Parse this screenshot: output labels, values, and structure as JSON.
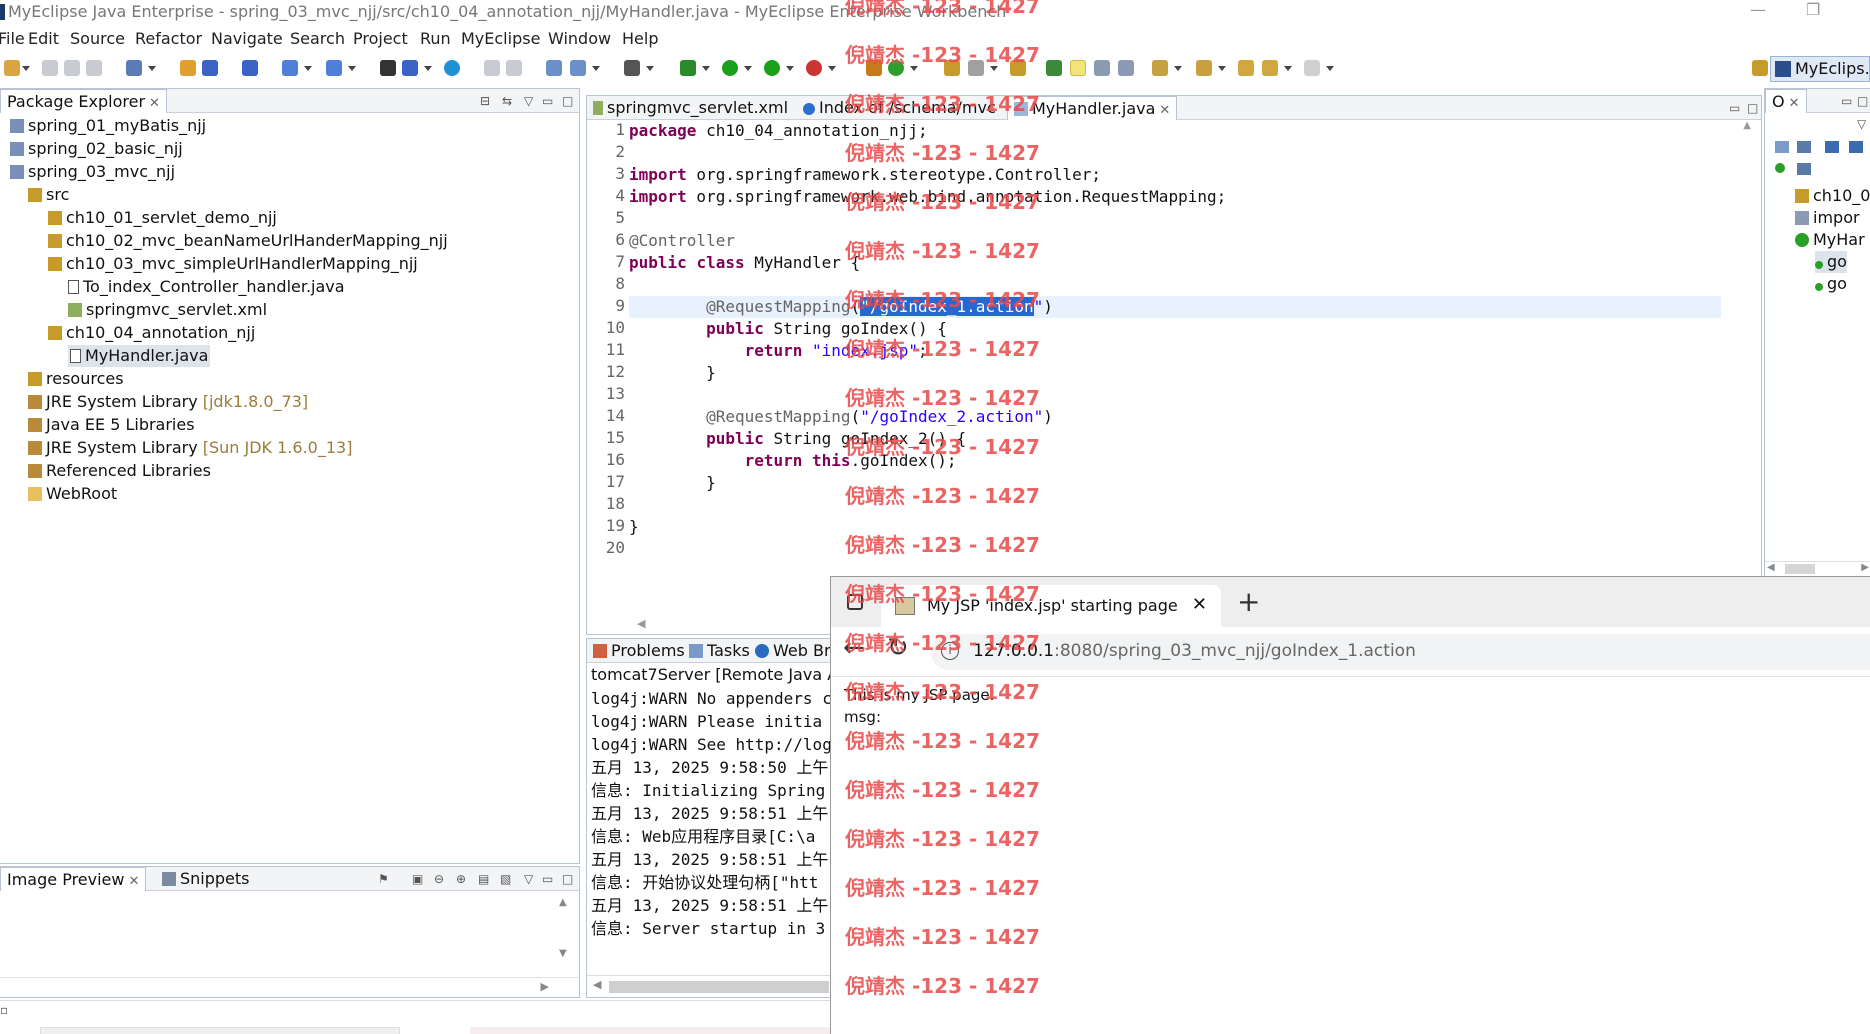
{
  "window": {
    "title": "MyEclipse Java Enterprise - spring_03_mvc_njj/src/ch10_04_annotation_njj/MyHandler.java - MyEclipse Enterprise Workbench"
  },
  "menu": [
    "File",
    "Edit",
    "Source",
    "Refactor",
    "Navigate",
    "Search",
    "Project",
    "Run",
    "MyEclipse",
    "Window",
    "Help"
  ],
  "perspective": {
    "label": "MyEclips..."
  },
  "package_explorer": {
    "title": "Package Explorer",
    "items": [
      {
        "label": "spring_01_myBatis_njj",
        "icon": "project-icon",
        "level": 0
      },
      {
        "label": "spring_02_basic_njj",
        "icon": "project-icon",
        "level": 0
      },
      {
        "label": "spring_03_mvc_njj",
        "icon": "project-icon",
        "level": 0
      },
      {
        "label": "src",
        "icon": "source-folder-icon",
        "level": 1
      },
      {
        "label": "ch10_01_servlet_demo_njj",
        "icon": "package-icon",
        "level": 2
      },
      {
        "label": "ch10_02_mvc_beanNameUrlHanderMapping_njj",
        "icon": "package-icon",
        "level": 2
      },
      {
        "label": "ch10_03_mvc_simpleUrlHandlerMapping_njj",
        "icon": "package-icon",
        "level": 2
      },
      {
        "label": "To_index_Controller_handler.java",
        "icon": "java-file-icon",
        "level": 3
      },
      {
        "label": "springmvc_servlet.xml",
        "icon": "xml-file-icon",
        "level": 3
      },
      {
        "label": "ch10_04_annotation_njj",
        "icon": "package-icon",
        "level": 2
      },
      {
        "label": "MyHandler.java",
        "icon": "java-file-icon",
        "level": 3,
        "selected": true
      },
      {
        "label": "resources",
        "icon": "source-folder-icon",
        "level": 1
      },
      {
        "label": "JRE System Library",
        "decoration": "[jdk1.8.0_73]",
        "icon": "library-icon",
        "level": 1
      },
      {
        "label": "Java EE 5 Libraries",
        "icon": "library-icon",
        "level": 1
      },
      {
        "label": "JRE System Library",
        "decoration": "[Sun JDK 1.6.0_13]",
        "icon": "library-icon",
        "level": 1
      },
      {
        "label": "Referenced Libraries",
        "icon": "library-icon",
        "level": 1
      },
      {
        "label": "WebRoot",
        "icon": "folder-icon",
        "level": 1
      }
    ]
  },
  "bottom_left": {
    "tabs": [
      "Image Preview",
      "Snippets"
    ]
  },
  "editor": {
    "tabs": [
      "springmvc_servlet.xml",
      "Index of /schema/mvc",
      "MyHandler.java"
    ],
    "active_tab": 2,
    "line_numbers": [
      "1",
      "2",
      "3",
      "4",
      "5",
      "6",
      "7",
      "8",
      "9",
      "10",
      "11",
      "12",
      "13",
      "14",
      "15",
      "16",
      "17",
      "18",
      "19",
      "20"
    ]
  },
  "outline": {
    "title": "O",
    "items": [
      "ch10_0",
      "impor",
      "MyHar",
      "go",
      "go"
    ]
  },
  "console": {
    "tabs": [
      "Problems",
      "Tasks",
      "Web Bro"
    ],
    "header": "tomcat7Server [Remote Java App",
    "lines": [
      "log4j:WARN No appenders c",
      "log4j:WARN Please initia",
      "log4j:WARN See http://log",
      "五月 13, 2025 9:58:50 上午",
      "信息: Initializing Spring",
      "五月 13, 2025 9:58:51 上午",
      "信息: Web应用程序目录[C:\\a",
      "五月 13, 2025 9:58:51 上午",
      "信息: 开始协议处理句柄[\"htt",
      "五月 13, 2025 9:58:51 上午",
      "信息: Server startup in 3"
    ]
  },
  "browser": {
    "tab_title": "My JSP 'index.jsp' starting page",
    "url_host": "127.0.0.1",
    "url_rest": ":8080/spring_03_mvc_njj/goIndex_1.action",
    "body_line1": "This is my JSP page.",
    "body_line2": "msg:"
  },
  "watermark": "倪靖杰 -123 - 1427"
}
